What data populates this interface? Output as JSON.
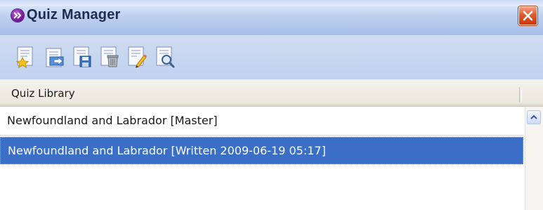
{
  "window": {
    "title": "Quiz Manager",
    "close_icon": "close-icon"
  },
  "toolbar": {
    "buttons": [
      {
        "name": "new-quiz",
        "icon": "new-document-star-icon"
      },
      {
        "name": "import-quiz",
        "icon": "import-document-icon"
      },
      {
        "name": "save-quiz",
        "icon": "save-document-icon"
      },
      {
        "name": "delete-quiz",
        "icon": "delete-document-icon"
      },
      {
        "name": "edit-quiz",
        "icon": "edit-document-pencil-icon"
      },
      {
        "name": "preview-quiz",
        "icon": "preview-document-magnifier-icon"
      }
    ]
  },
  "library": {
    "column_header": "Quiz Library",
    "items": [
      {
        "label": "Newfoundland and Labrador [Master]",
        "selected": false
      },
      {
        "label": "Newfoundland and Labrador [Written 2009-06-19 05:17]",
        "selected": true
      }
    ]
  },
  "colors": {
    "selection": "#3b6ec7",
    "title_text": "#1c2a54",
    "close_button": "#e2592c",
    "orb": "#7a1fa0"
  }
}
